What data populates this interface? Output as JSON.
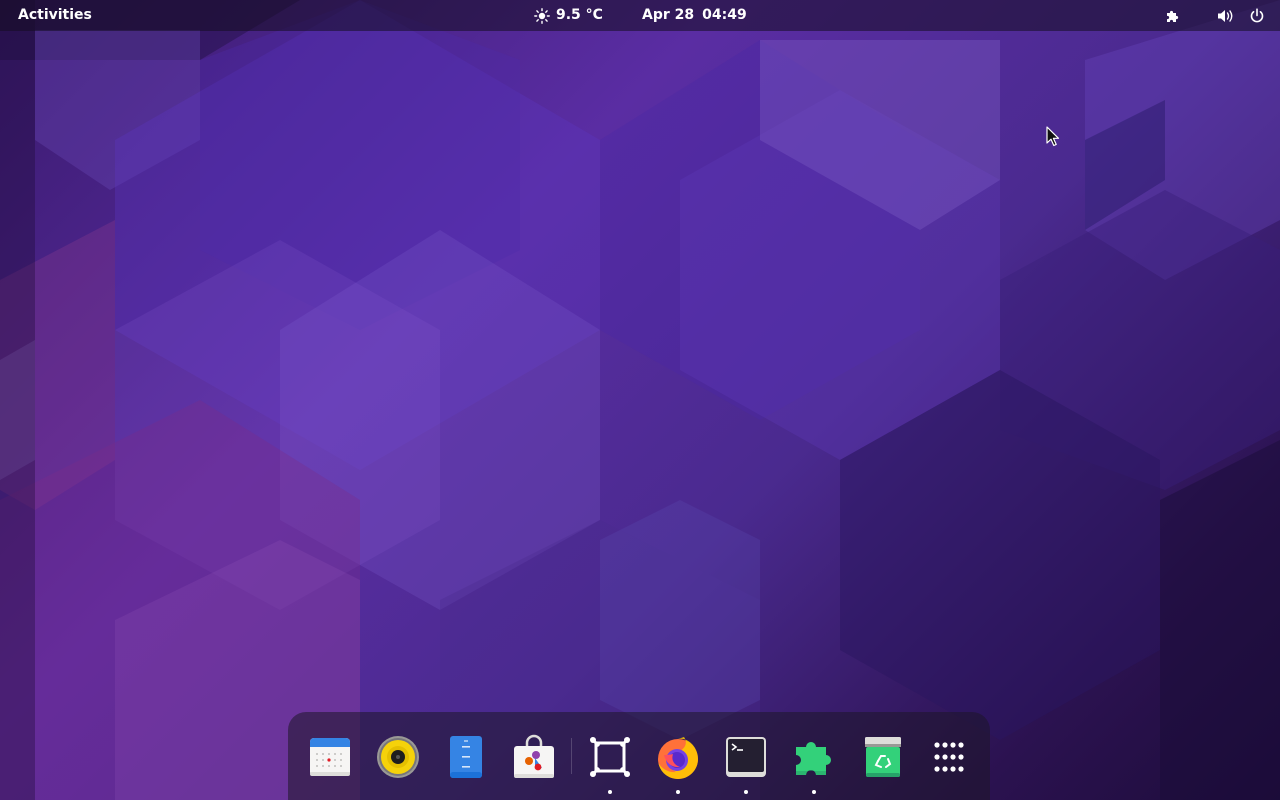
{
  "topbar": {
    "activities_label": "Activities",
    "weather": {
      "icon": "sun-icon",
      "temperature": "9.5 °C"
    },
    "clock": {
      "date": "Apr 28",
      "time": "04:49"
    },
    "tray": {
      "extensions_icon": "puzzle-icon",
      "volume_icon": "volume-icon",
      "power_icon": "power-icon"
    }
  },
  "dock": {
    "items": [
      {
        "name": "Calendar",
        "icon": "calendar-icon",
        "running": false
      },
      {
        "name": "Rhythmbox",
        "icon": "speaker-icon",
        "running": false
      },
      {
        "name": "File Roller",
        "icon": "archive-icon",
        "running": false
      },
      {
        "name": "Software",
        "icon": "software-store-icon",
        "running": false
      },
      {
        "name": "Screen Capture",
        "icon": "frame-icon",
        "running": true
      },
      {
        "name": "Firefox",
        "icon": "firefox-icon",
        "running": true
      },
      {
        "name": "Terminal",
        "icon": "terminal-icon",
        "running": true
      },
      {
        "name": "Extensions",
        "icon": "puzzle-icon",
        "running": true
      },
      {
        "name": "Trash",
        "icon": "trash-icon",
        "running": false
      },
      {
        "name": "Show Applications",
        "icon": "app-grid-icon",
        "running": false
      }
    ]
  },
  "colors": {
    "wallpaper_base": "#4a2a8f",
    "topbar_text": "#ffffff",
    "extensions_green": "#33d17a",
    "folder_blue": "#3584e4"
  }
}
